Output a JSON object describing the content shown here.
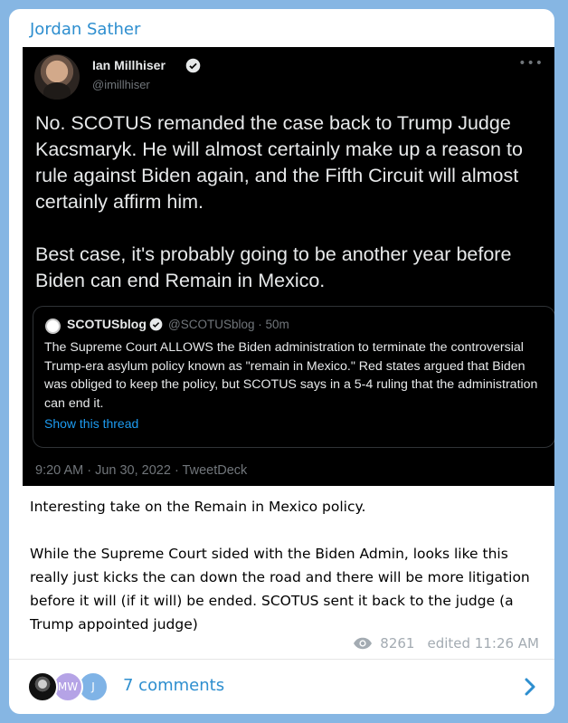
{
  "channel": {
    "name": "Jordan Sather"
  },
  "tweet": {
    "author_name": "Ian Millhiser",
    "author_handle": "@imillhiser",
    "text": "No. SCOTUS remanded the case back to Trump Judge Kacsmaryk. He will almost certainly make up a reason to rule against Biden again, and the Fifth Circuit will almost certainly affirm him.\n\nBest case, it's probably going to be another year before Biden can end Remain in Mexico.",
    "quote": {
      "name": "SCOTUSblog",
      "handle_time": "@SCOTUSblog · 50m",
      "text": "The Supreme Court ALLOWS the Biden administration to terminate the controversial Trump-era asylum policy known as \"remain in Mexico.\" Red states argued that Biden was obliged to keep the policy, but SCOTUS says in a 5-4 ruling that the administration can end it.",
      "show_thread": "Show this thread"
    },
    "meta": "9:20 AM · Jun 30, 2022 · TweetDeck"
  },
  "post": {
    "text": "Interesting take on the Remain in Mexico policy.\n\nWhile the Supreme Court sided with the Biden Admin, looks like this really just kicks the can down the road and there will be more litigation before it will (if it will) be ended. SCOTUS sent it back to the judge (a Trump appointed judge)",
    "views": "8261",
    "edited": "edited 11:26 AM"
  },
  "comments": {
    "label": "7 comments",
    "avatars": [
      "",
      "MW",
      "J"
    ]
  },
  "colors": {
    "accent": "#2d8ecf",
    "twitter_blue": "#1d9bf0",
    "background": "#86b6e3"
  },
  "icons": [
    "verified-badge-icon",
    "more-dots-icon",
    "eye-icon",
    "chevron-right-icon"
  ]
}
